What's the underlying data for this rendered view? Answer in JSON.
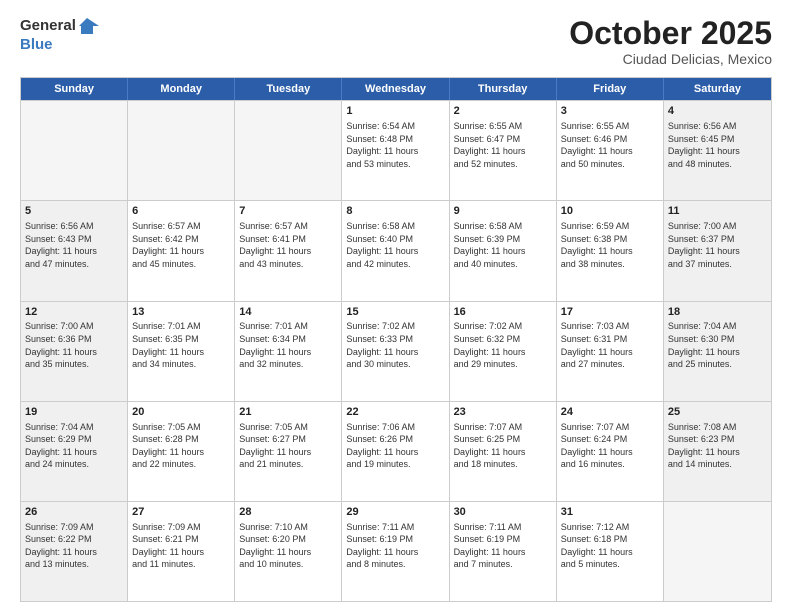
{
  "logo": {
    "general": "General",
    "blue": "Blue"
  },
  "title": "October 2025",
  "subtitle": "Ciudad Delicias, Mexico",
  "weekdays": [
    "Sunday",
    "Monday",
    "Tuesday",
    "Wednesday",
    "Thursday",
    "Friday",
    "Saturday"
  ],
  "rows": [
    [
      {
        "day": "",
        "text": "",
        "empty": true
      },
      {
        "day": "",
        "text": "",
        "empty": true
      },
      {
        "day": "",
        "text": "",
        "empty": true
      },
      {
        "day": "1",
        "text": "Sunrise: 6:54 AM\nSunset: 6:48 PM\nDaylight: 11 hours\nand 53 minutes."
      },
      {
        "day": "2",
        "text": "Sunrise: 6:55 AM\nSunset: 6:47 PM\nDaylight: 11 hours\nand 52 minutes."
      },
      {
        "day": "3",
        "text": "Sunrise: 6:55 AM\nSunset: 6:46 PM\nDaylight: 11 hours\nand 50 minutes."
      },
      {
        "day": "4",
        "text": "Sunrise: 6:56 AM\nSunset: 6:45 PM\nDaylight: 11 hours\nand 48 minutes."
      }
    ],
    [
      {
        "day": "5",
        "text": "Sunrise: 6:56 AM\nSunset: 6:43 PM\nDaylight: 11 hours\nand 47 minutes."
      },
      {
        "day": "6",
        "text": "Sunrise: 6:57 AM\nSunset: 6:42 PM\nDaylight: 11 hours\nand 45 minutes."
      },
      {
        "day": "7",
        "text": "Sunrise: 6:57 AM\nSunset: 6:41 PM\nDaylight: 11 hours\nand 43 minutes."
      },
      {
        "day": "8",
        "text": "Sunrise: 6:58 AM\nSunset: 6:40 PM\nDaylight: 11 hours\nand 42 minutes."
      },
      {
        "day": "9",
        "text": "Sunrise: 6:58 AM\nSunset: 6:39 PM\nDaylight: 11 hours\nand 40 minutes."
      },
      {
        "day": "10",
        "text": "Sunrise: 6:59 AM\nSunset: 6:38 PM\nDaylight: 11 hours\nand 38 minutes."
      },
      {
        "day": "11",
        "text": "Sunrise: 7:00 AM\nSunset: 6:37 PM\nDaylight: 11 hours\nand 37 minutes."
      }
    ],
    [
      {
        "day": "12",
        "text": "Sunrise: 7:00 AM\nSunset: 6:36 PM\nDaylight: 11 hours\nand 35 minutes."
      },
      {
        "day": "13",
        "text": "Sunrise: 7:01 AM\nSunset: 6:35 PM\nDaylight: 11 hours\nand 34 minutes."
      },
      {
        "day": "14",
        "text": "Sunrise: 7:01 AM\nSunset: 6:34 PM\nDaylight: 11 hours\nand 32 minutes."
      },
      {
        "day": "15",
        "text": "Sunrise: 7:02 AM\nSunset: 6:33 PM\nDaylight: 11 hours\nand 30 minutes."
      },
      {
        "day": "16",
        "text": "Sunrise: 7:02 AM\nSunset: 6:32 PM\nDaylight: 11 hours\nand 29 minutes."
      },
      {
        "day": "17",
        "text": "Sunrise: 7:03 AM\nSunset: 6:31 PM\nDaylight: 11 hours\nand 27 minutes."
      },
      {
        "day": "18",
        "text": "Sunrise: 7:04 AM\nSunset: 6:30 PM\nDaylight: 11 hours\nand 25 minutes."
      }
    ],
    [
      {
        "day": "19",
        "text": "Sunrise: 7:04 AM\nSunset: 6:29 PM\nDaylight: 11 hours\nand 24 minutes."
      },
      {
        "day": "20",
        "text": "Sunrise: 7:05 AM\nSunset: 6:28 PM\nDaylight: 11 hours\nand 22 minutes."
      },
      {
        "day": "21",
        "text": "Sunrise: 7:05 AM\nSunset: 6:27 PM\nDaylight: 11 hours\nand 21 minutes."
      },
      {
        "day": "22",
        "text": "Sunrise: 7:06 AM\nSunset: 6:26 PM\nDaylight: 11 hours\nand 19 minutes."
      },
      {
        "day": "23",
        "text": "Sunrise: 7:07 AM\nSunset: 6:25 PM\nDaylight: 11 hours\nand 18 minutes."
      },
      {
        "day": "24",
        "text": "Sunrise: 7:07 AM\nSunset: 6:24 PM\nDaylight: 11 hours\nand 16 minutes."
      },
      {
        "day": "25",
        "text": "Sunrise: 7:08 AM\nSunset: 6:23 PM\nDaylight: 11 hours\nand 14 minutes."
      }
    ],
    [
      {
        "day": "26",
        "text": "Sunrise: 7:09 AM\nSunset: 6:22 PM\nDaylight: 11 hours\nand 13 minutes."
      },
      {
        "day": "27",
        "text": "Sunrise: 7:09 AM\nSunset: 6:21 PM\nDaylight: 11 hours\nand 11 minutes."
      },
      {
        "day": "28",
        "text": "Sunrise: 7:10 AM\nSunset: 6:20 PM\nDaylight: 11 hours\nand 10 minutes."
      },
      {
        "day": "29",
        "text": "Sunrise: 7:11 AM\nSunset: 6:19 PM\nDaylight: 11 hours\nand 8 minutes."
      },
      {
        "day": "30",
        "text": "Sunrise: 7:11 AM\nSunset: 6:19 PM\nDaylight: 11 hours\nand 7 minutes."
      },
      {
        "day": "31",
        "text": "Sunrise: 7:12 AM\nSunset: 6:18 PM\nDaylight: 11 hours\nand 5 minutes."
      },
      {
        "day": "",
        "text": "",
        "empty": true
      }
    ]
  ],
  "colors": {
    "header_bg": "#2b5da8",
    "header_text": "#ffffff",
    "border": "#cccccc",
    "shaded": "#f0f0f0"
  }
}
